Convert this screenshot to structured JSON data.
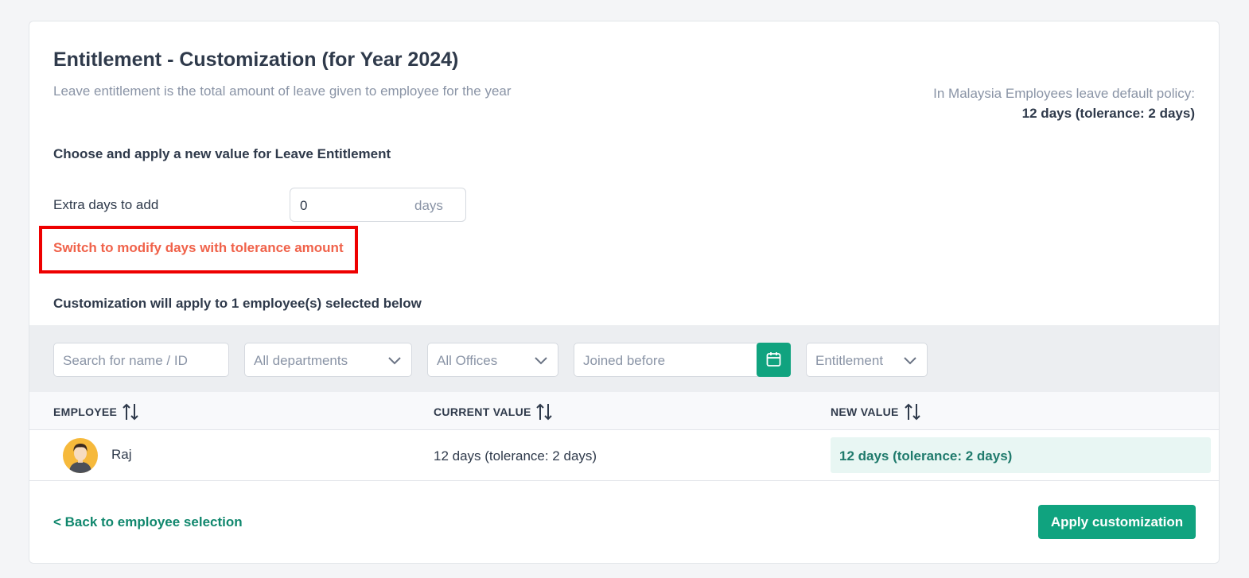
{
  "header": {
    "title": "Entitlement - Customization (for Year 2024)",
    "subtitle": "Leave entitlement is the total amount of leave given to employee for the year",
    "policy_label": "In Malaysia Employees leave default policy:",
    "policy_value": "12 days (tolerance: 2 days)"
  },
  "form": {
    "choose_label": "Choose and apply a new value for Leave Entitlement",
    "extra_label": "Extra days to add",
    "extra_value": "0",
    "extra_unit": "days",
    "switch_link": "Switch to modify days with tolerance amount",
    "apply_note": "Customization will apply to 1 employee(s) selected below"
  },
  "filters": {
    "search_placeholder": "Search for name / ID",
    "departments": "All departments",
    "offices": "All Offices",
    "joined_placeholder": "Joined before",
    "entitlement": "Entitlement"
  },
  "table": {
    "headers": [
      "EMPLOYEE",
      "CURRENT VALUE",
      "NEW VALUE"
    ],
    "rows": [
      {
        "name": "Raj",
        "current": "12 days (tolerance: 2 days)",
        "new": "12 days (tolerance: 2 days)"
      }
    ]
  },
  "footer": {
    "back_link": "< Back to employee selection",
    "apply_button": "Apply customization"
  },
  "colors": {
    "accent": "#10a37f",
    "link_warning": "#f0624a",
    "highlight_border": "#ee0000"
  },
  "icons": [
    "chevron-down-icon",
    "calendar-icon",
    "sort-icon",
    "avatar"
  ]
}
